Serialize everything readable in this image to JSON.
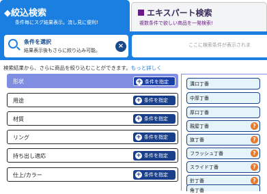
{
  "tabs": {
    "narrow": {
      "title": "◆絞込検索",
      "sub": "条件毎にスグ結果表示。流し見に便利!"
    },
    "expert": {
      "title": "エキスパート検索",
      "sub": "複数条件で欲しい商品を一発検索!"
    }
  },
  "condition": {
    "title": "条件を選択",
    "sub": "結果表示後もさらに絞り込み可能。",
    "close_icon": "×"
  },
  "result": {
    "placeholder": "ここに検索条件が表示されま"
  },
  "info": {
    "text": "検索結果から、さらに商品を絞り込むことができます。",
    "more": "もっと詳しく"
  },
  "rows": [
    {
      "label": "形状",
      "button": "条件を指定"
    },
    {
      "label": "用途",
      "button": "条件を指定"
    },
    {
      "label": "材質",
      "button": "条件を指定"
    },
    {
      "label": "リング",
      "button": "条件を指定"
    },
    {
      "label": "持ち出し適応",
      "button": "条件を指定"
    },
    {
      "label": "仕上/カラー",
      "button": "条件を指定"
    }
  ],
  "plus_icon": "+",
  "question_icon": "?",
  "chips": [
    {
      "label": "溝口丁番",
      "help": false
    },
    {
      "label": "中厚丁番",
      "help": false
    },
    {
      "label": "厚口丁番",
      "help": false
    },
    {
      "label": "親屋丁番",
      "help": true
    },
    {
      "label": "旗丁番",
      "help": true
    },
    {
      "label": "フラッシュ丁番",
      "help": true
    },
    {
      "label": "スライド丁番",
      "help": true
    },
    {
      "label": "針丁番",
      "help": true
    },
    {
      "label": "角丁番",
      "help": false
    }
  ],
  "colors": {
    "primary": "#1a7fe0",
    "selected_row": "#7f8ee0",
    "button": "#1a3f8a",
    "help": "#e87a2a",
    "expert_accent": "#6b1b86"
  }
}
